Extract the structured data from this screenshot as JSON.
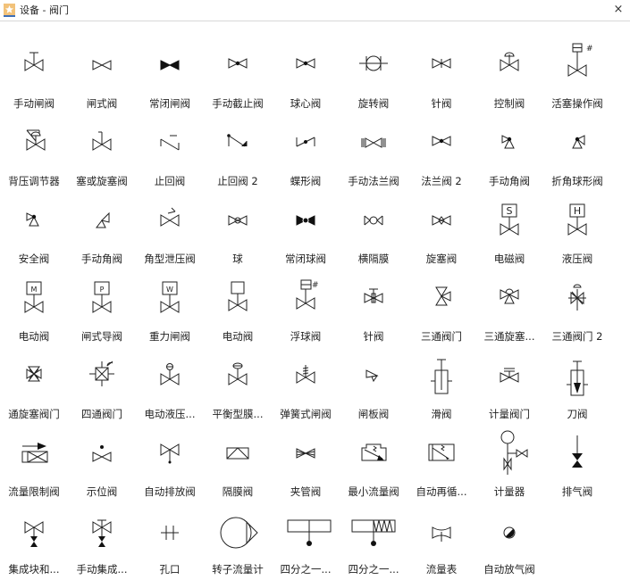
{
  "window": {
    "title": "设备 - 阀门",
    "app_icon": "star-icon",
    "close_icon": "close-icon",
    "close_glyph": "×"
  },
  "colors": {
    "stroke": "#222222",
    "fill_dark": "#111111",
    "app_icon_bg": "#f2c27a",
    "app_icon_bar": "#3d6fb8"
  },
  "shapes": [
    {
      "label": "手动闸阀",
      "icon": "manual-gate-valve"
    },
    {
      "label": "闸式阀",
      "icon": "gate-valve"
    },
    {
      "label": "常闭闸阀",
      "icon": "normally-closed-gate-valve"
    },
    {
      "label": "手动截止阀",
      "icon": "manual-globe-valve"
    },
    {
      "label": "球心阀",
      "icon": "globe-valve"
    },
    {
      "label": "旋转阀",
      "icon": "rotary-valve"
    },
    {
      "label": "针阀",
      "icon": "needle-valve"
    },
    {
      "label": "控制阀",
      "icon": "control-valve"
    },
    {
      "label": "活塞操作阀",
      "icon": "piston-operated-valve"
    },
    {
      "label": "背压调节器",
      "icon": "back-pressure-regulator"
    },
    {
      "label": "塞或旋塞阀",
      "icon": "plug-cock-valve"
    },
    {
      "label": "止回阀",
      "icon": "check-valve"
    },
    {
      "label": "止回阀 2",
      "icon": "check-valve-2"
    },
    {
      "label": "蝶形阀",
      "icon": "butterfly-valve"
    },
    {
      "label": "手动法兰阀",
      "icon": "manual-flanged-valve"
    },
    {
      "label": "法兰阀 2",
      "icon": "flanged-valve-2"
    },
    {
      "label": "手动角阀",
      "icon": "manual-angle-valve"
    },
    {
      "label": "折角球形阀",
      "icon": "angle-globe-valve"
    },
    {
      "label": "安全阀",
      "icon": "safety-valve"
    },
    {
      "label": "手动角阀",
      "icon": "manual-angle-valve-2"
    },
    {
      "label": "角型泄压阀",
      "icon": "angle-relief-valve"
    },
    {
      "label": "球",
      "icon": "ball"
    },
    {
      "label": "常闭球阀",
      "icon": "normally-closed-ball-valve"
    },
    {
      "label": "横隔膜",
      "icon": "diaphragm"
    },
    {
      "label": "旋塞阀",
      "icon": "cock-valve"
    },
    {
      "label": "电磁阀",
      "icon": "solenoid-valve",
      "letter": "S"
    },
    {
      "label": "液压阀",
      "icon": "hydraulic-valve",
      "letter": "H"
    },
    {
      "label": "电动阀",
      "icon": "motor-valve",
      "letter": "M"
    },
    {
      "label": "闸式导阀",
      "icon": "pilot-gate-valve",
      "letter": "P"
    },
    {
      "label": "重力闸阀",
      "icon": "weight-gate-valve",
      "letter": "W"
    },
    {
      "label": "电动阀",
      "icon": "electric-valve"
    },
    {
      "label": "浮球阀",
      "icon": "float-valve"
    },
    {
      "label": "针阀",
      "icon": "needle-valve-2"
    },
    {
      "label": "三通阀门",
      "icon": "three-way-valve"
    },
    {
      "label": "三通旋塞...",
      "icon": "three-way-plug-valve"
    },
    {
      "label": "三通阀门 2",
      "icon": "three-way-valve-2"
    },
    {
      "label": "通旋塞阀门",
      "icon": "four-way-plug-valve"
    },
    {
      "label": "四通阀门",
      "icon": "four-way-valve"
    },
    {
      "label": "电动液压...",
      "icon": "electro-hydraulic-valve"
    },
    {
      "label": "平衡型膜...",
      "icon": "balanced-diaphragm-valve"
    },
    {
      "label": "弹簧式闸阀",
      "icon": "spring-gate-valve"
    },
    {
      "label": "闸板阀",
      "icon": "slide-gate-valve"
    },
    {
      "label": "滑阀",
      "icon": "slide-valve"
    },
    {
      "label": "计量阀门",
      "icon": "metering-valve"
    },
    {
      "label": "刀阀",
      "icon": "knife-valve"
    },
    {
      "label": "流量限制阀",
      "icon": "flow-limiting-valve"
    },
    {
      "label": "示位阀",
      "icon": "indicator-valve"
    },
    {
      "label": "自动排放阀",
      "icon": "auto-drain-valve"
    },
    {
      "label": "隔膜阀",
      "icon": "diaphragm-valve"
    },
    {
      "label": "夹管阀",
      "icon": "pinch-valve"
    },
    {
      "label": "最小流量阀",
      "icon": "min-flow-valve"
    },
    {
      "label": "自动再循...",
      "icon": "auto-recirculation-valve"
    },
    {
      "label": "计量器",
      "icon": "gauge"
    },
    {
      "label": "排气阀",
      "icon": "vent-valve"
    },
    {
      "label": "集成块和...",
      "icon": "integral-block-valve"
    },
    {
      "label": "手动集成...",
      "icon": "manual-integral-valve"
    },
    {
      "label": "孔口",
      "icon": "orifice"
    },
    {
      "label": "转子流量计",
      "icon": "rotameter"
    },
    {
      "label": "四分之一...",
      "icon": "quarter-turn-valve"
    },
    {
      "label": "四分之一...",
      "icon": "quarter-turn-spring-valve"
    },
    {
      "label": "流量表",
      "icon": "flow-meter"
    },
    {
      "label": "自动放气阀",
      "icon": "auto-air-vent"
    }
  ]
}
